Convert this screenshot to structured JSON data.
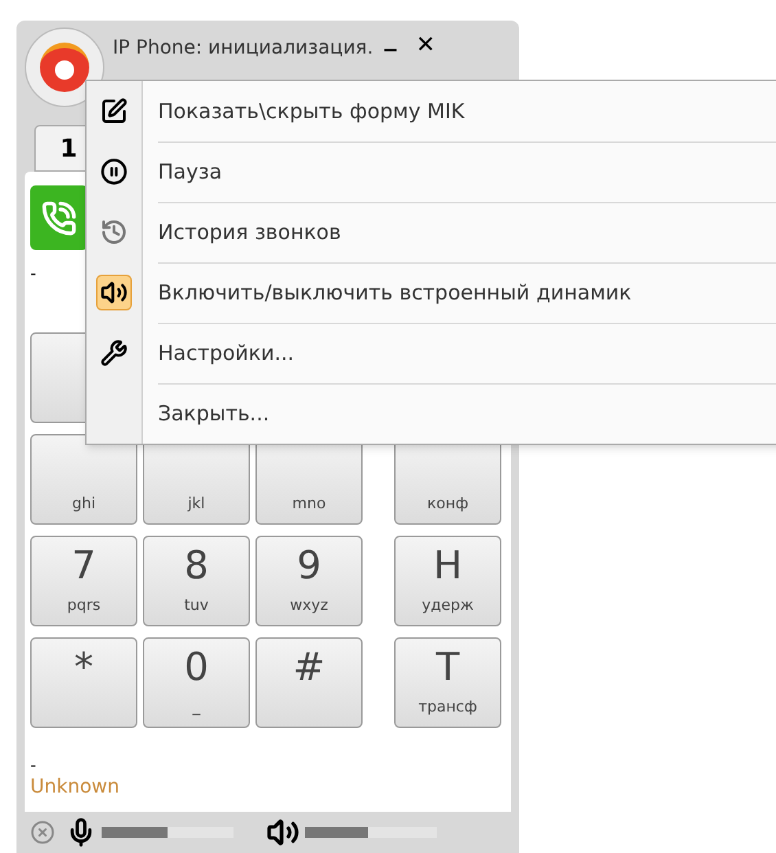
{
  "window": {
    "title": "IP Phone: инициализация.",
    "minimize": "_",
    "close": "✕"
  },
  "tabs": [
    {
      "label": "1",
      "selected": true
    }
  ],
  "call_status": "-",
  "keypad": [
    [
      {
        "letters": "ghi"
      },
      {
        "letters": "jkl"
      },
      {
        "letters": "mno"
      },
      {
        "letters": "конф"
      }
    ],
    [
      {
        "digit": "7",
        "letters": "pqrs"
      },
      {
        "digit": "8",
        "letters": "tuv"
      },
      {
        "digit": "9",
        "letters": "wxyz"
      },
      {
        "digit": "H",
        "letters": "удерж"
      }
    ],
    [
      {
        "digit": "*"
      },
      {
        "digit": "0",
        "letters": "_"
      },
      {
        "digit": "#"
      },
      {
        "digit": "T",
        "letters": "трансф"
      }
    ]
  ],
  "caller": {
    "number": "-",
    "name": "Unknown"
  },
  "status_bar": {
    "mic": {
      "level": 0.5
    },
    "speaker": {
      "level": 0.48
    }
  },
  "menu": [
    {
      "kind": "form",
      "label": "Показать\\скрыть форму MIK",
      "checked": false
    },
    {
      "kind": "pause",
      "label": "Пауза",
      "checked": false
    },
    {
      "kind": "history",
      "label": "История звонков",
      "checked": false
    },
    {
      "kind": "speaker",
      "label": "Включить/выключить встроенный динамик",
      "checked": true
    },
    {
      "kind": "settings",
      "label": "Настройки...",
      "checked": false
    },
    {
      "kind": "close",
      "label": "Закрыть...",
      "checked": false
    }
  ]
}
